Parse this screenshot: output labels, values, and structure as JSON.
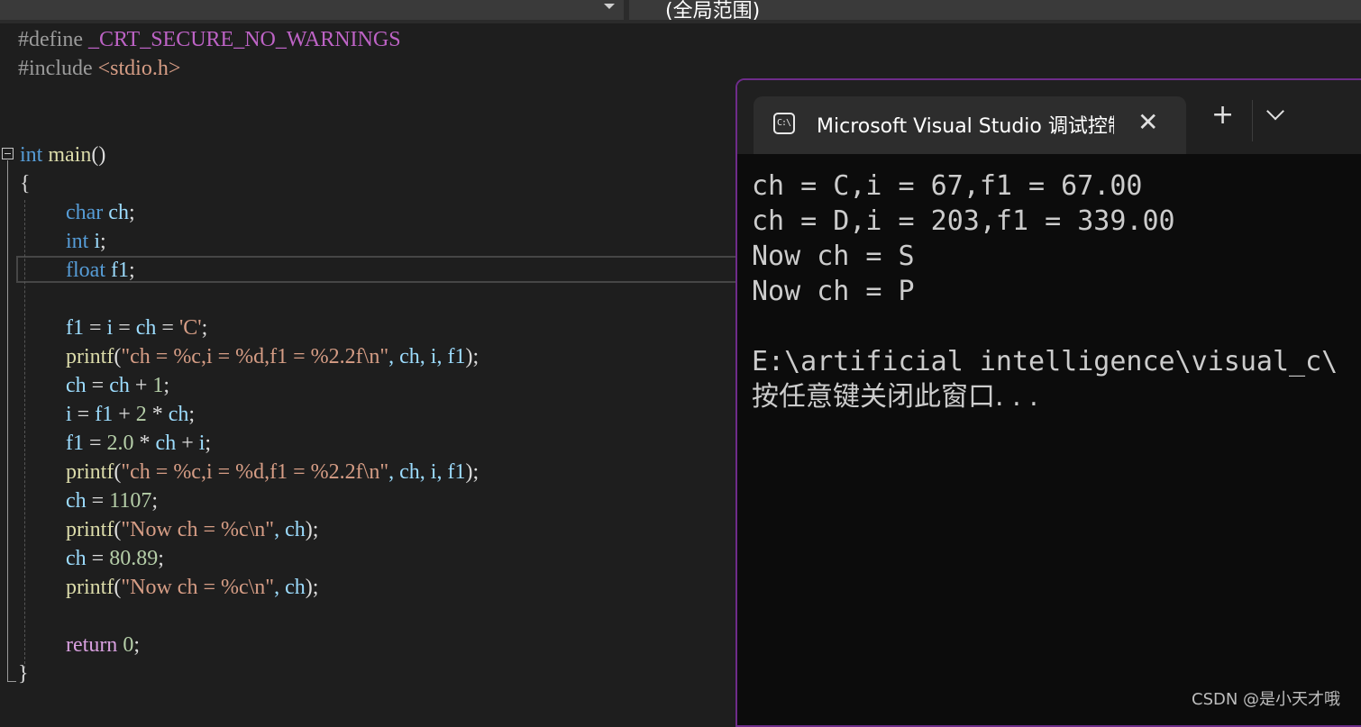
{
  "toolbar": {
    "scope_label": "(全局范围)"
  },
  "editor": {
    "lines": {
      "l1_pp": "#define",
      "l1_mac": " _CRT_SECURE_NO_WARNINGS",
      "l2_pp": "#include",
      "l2_inc": " <stdio.h>",
      "l5_kw": "int",
      "l5_fn": " main",
      "l5_rest": "()",
      "l6": "{",
      "l7_kw": "char",
      "l7_var": " ch",
      "l7_rest": ";",
      "l8_kw": "int",
      "l8_var": " i",
      "l8_rest": ";",
      "l9_kw": "float",
      "l9_var": " f1",
      "l9_rest": ";",
      "l11_var1": "f1",
      "l11_op1": " = ",
      "l11_var2": "i",
      "l11_op2": " = ",
      "l11_var3": "ch",
      "l11_op3": " = ",
      "l11_str": "'C'",
      "l11_end": ";",
      "l12_fn": "printf",
      "l12_open": "(",
      "l12_str": "\"ch = %c,i = %d,f1 = %2.2f\\n\"",
      "l12_args": ", ch, i, f1",
      "l12_end": ");",
      "l13_var1": "ch",
      "l13_op": " = ",
      "l13_var2": "ch",
      "l13_plus": " + ",
      "l13_num": "1",
      "l13_end": ";",
      "l14_var1": "i",
      "l14_op": " = ",
      "l14_var2": "f1",
      "l14_plus": " + ",
      "l14_num": "2",
      "l14_mul": " * ",
      "l14_var3": "ch",
      "l14_end": ";",
      "l15_var1": "f1",
      "l15_op": " = ",
      "l15_num": "2.0",
      "l15_mul": " * ",
      "l15_var2": "ch",
      "l15_plus": " + ",
      "l15_var3": "i",
      "l15_end": ";",
      "l16_fn": "printf",
      "l16_open": "(",
      "l16_str": "\"ch = %c,i = %d,f1 = %2.2f\\n\"",
      "l16_args": ", ch, i, f1",
      "l16_end": ");",
      "l17_var": "ch",
      "l17_op": " = ",
      "l17_num": "1107",
      "l17_end": ";",
      "l18_fn": "printf",
      "l18_open": "(",
      "l18_str": "\"Now ch = %c\\n\"",
      "l18_args": ", ch",
      "l18_end": ");",
      "l19_var": "ch",
      "l19_op": " = ",
      "l19_num": "80.89",
      "l19_end": ";",
      "l20_fn": "printf",
      "l20_open": "(",
      "l20_str": "\"Now ch = %c\\n\"",
      "l20_args": ", ch",
      "l20_end": ");",
      "l22_kw": "return",
      "l22_num": " 0",
      "l22_end": ";",
      "l23": "}"
    }
  },
  "terminal": {
    "tab_title": "Microsoft Visual Studio 调试控制台",
    "tab_icon_glyph": "C:\\",
    "close_glyph": "✕",
    "new_tab_glyph": "+",
    "output": [
      "ch = C,i = 67,f1 = 67.00",
      "ch = D,i = 203,f1 = 339.00",
      "Now ch = S",
      "Now ch = P",
      "",
      "E:\\artificial intelligence\\visual_c\\",
      "按任意键关闭此窗口. . ."
    ]
  },
  "watermark": "CSDN @是小天才哦",
  "colors": {
    "editor_bg": "#1e1e1e",
    "keyword": "#569cd6",
    "function": "#dcdcaa",
    "variable": "#9cdcfe",
    "string": "#d69d85",
    "number": "#b5cea8",
    "control": "#d8a0df",
    "terminal_bg": "#0c0c0c",
    "terminal_border": "#6e2c8a"
  }
}
